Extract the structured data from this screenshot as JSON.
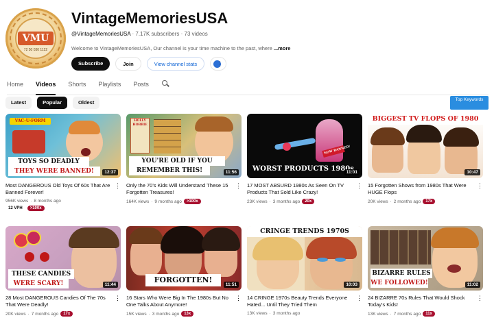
{
  "channel": {
    "name": "VintageMemoriesUSA",
    "handle": "@VintageMemoriesUSA",
    "subscribers": "7.17K subscribers",
    "videos_count": "73 videos",
    "separator": "·",
    "description": "Welcome to VintageMemoriesUSA, Our channel is your time machine to the past, where",
    "description_fade": " ...",
    "more_label": "...more",
    "avatar": {
      "monogram": "VMU",
      "years": "72 50 030 1122"
    }
  },
  "buttons": {
    "subscribe": "Subscribe",
    "join": "Join",
    "view_stats": "View channel stats"
  },
  "tabs": [
    "Home",
    "Videos",
    "Shorts",
    "Playlists",
    "Posts"
  ],
  "active_tab": "Videos",
  "filters": [
    "Latest",
    "Popular",
    "Oldest"
  ],
  "active_filter": "Popular",
  "top_keywords": "Top Keywords",
  "videos": [
    {
      "title": "Most DANGEROUS Old Toys Of 60s That Are Banned Forever!",
      "views": "956K views",
      "age": "8 months ago",
      "badge": "",
      "vph": "12 VPH",
      "multiplier": ">100x",
      "duration": "12:37",
      "overlay_line1": "TOYS SO DEADLY",
      "overlay_line2": "THEY WERE BANNED!",
      "thumb_top": "VAC-U-FORM"
    },
    {
      "title": "Only the 70's Kids Will Understand These 15 Forgotten Treasures!",
      "views": "164K views",
      "age": "9 months ago",
      "badge": ">100x",
      "duration": "11:56",
      "overlay_line1": "YOU'RE OLD IF YOU",
      "overlay_line2": "REMEMBER THIS!",
      "thumb_top": "HOLLY HOBBIE"
    },
    {
      "title": "17 MOST ABSURD 1980s As Seen On TV Products That Sold Like Crazy!",
      "views": "23K views",
      "age": "3 months ago",
      "badge": "20x",
      "duration": "11:01",
      "overlay_line1": "WORST PRODUCTS 1980s",
      "overlay_line2": "",
      "thumb_top": "NOW BANNED!"
    },
    {
      "title": "15 Forgotten Shows from 1980s That Were HUGE Flops",
      "views": "20K views",
      "age": "2 months ago",
      "badge": "17x",
      "duration": "10:47",
      "overlay_line1": "BIGGEST TV FLOPS OF 1980",
      "overlay_line2": "",
      "thumb_top": ""
    },
    {
      "title": "28 Most DANGEROUS Candies Of The 70s That Were Deadly!",
      "views": "20K views",
      "age": "7 months ago",
      "badge": "17x",
      "duration": "11:44",
      "overlay_line1": "THESE CANDIES",
      "overlay_line2": "WERE SCARY!",
      "thumb_top": ""
    },
    {
      "title": "16 Stars Who Were Big In The 1980s But No One Talks About Anymore!",
      "views": "15K views",
      "age": "3 months ago",
      "badge": "13x",
      "duration": "11:51",
      "overlay_line1": "FORGOTTEN!",
      "overlay_line2": "",
      "thumb_top": ""
    },
    {
      "title": "14 CRINGE 1970s Beauty Trends Everyone Hated... Until They Tried Them",
      "views": "13K views",
      "age": "3 months ago",
      "badge": "",
      "duration": "10:03",
      "overlay_line1": "CRINGE TRENDS 1970S",
      "overlay_line2": "",
      "thumb_top": ""
    },
    {
      "title": "24 BIZARRE 70s Rules That Would Shock Today's Kids!",
      "views": "13K views",
      "age": "7 months ago",
      "badge": "11x",
      "duration": "11:02",
      "overlay_line1": "BIZARRE RULES",
      "overlay_line2": "WE FOLLOWED!",
      "thumb_top": ""
    }
  ],
  "colors": {
    "accent_blue": "#065fd4",
    "badge_red": "#a8102f",
    "top_keywords_bg": "#2a8de0"
  }
}
